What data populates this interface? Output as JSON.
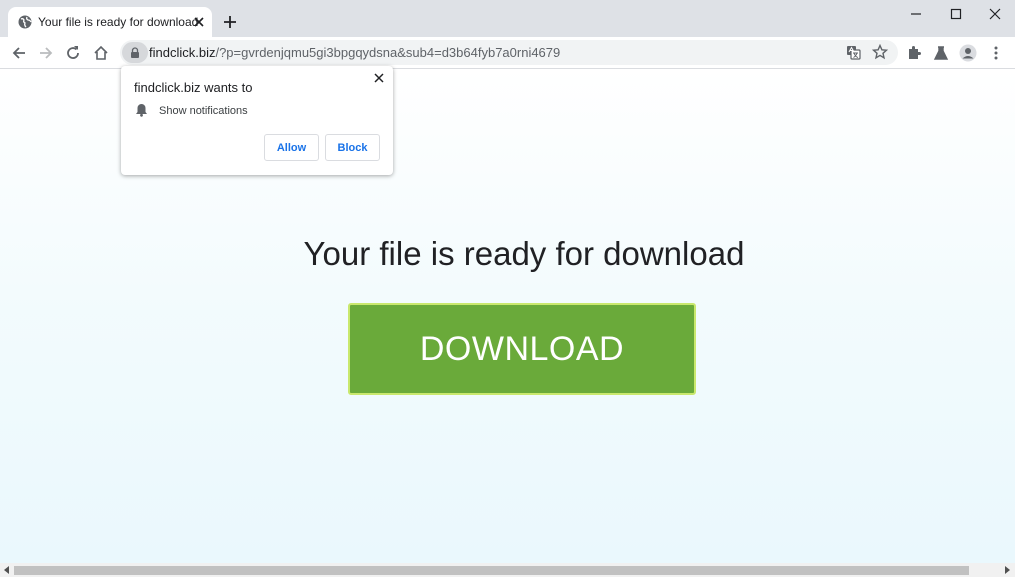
{
  "tab": {
    "title": "Your file is ready for download"
  },
  "address_bar": {
    "host": "findclick.biz",
    "path": "/?p=gvrdenjqmu5gi3bpgqydsna&sub4=d3b64fyb7a0rni4679"
  },
  "permission_popup": {
    "title": "findclick.biz wants to",
    "permission": "Show notifications",
    "allow_label": "Allow",
    "block_label": "Block"
  },
  "page": {
    "headline": "Your file is ready for download",
    "download_label": "DOWNLOAD"
  },
  "colors": {
    "download_button": "#6aaa3a",
    "download_border": "#c9e86e",
    "link_blue": "#1a73e8"
  },
  "icons": [
    "globe-icon",
    "close-icon",
    "plus-icon",
    "minimize-icon",
    "maximize-icon",
    "back-icon",
    "forward-icon",
    "reload-icon",
    "home-icon",
    "lock-icon",
    "translate-icon",
    "star-icon",
    "puzzle-icon",
    "flask-icon",
    "profile-icon",
    "menu-icon",
    "bell-icon"
  ]
}
